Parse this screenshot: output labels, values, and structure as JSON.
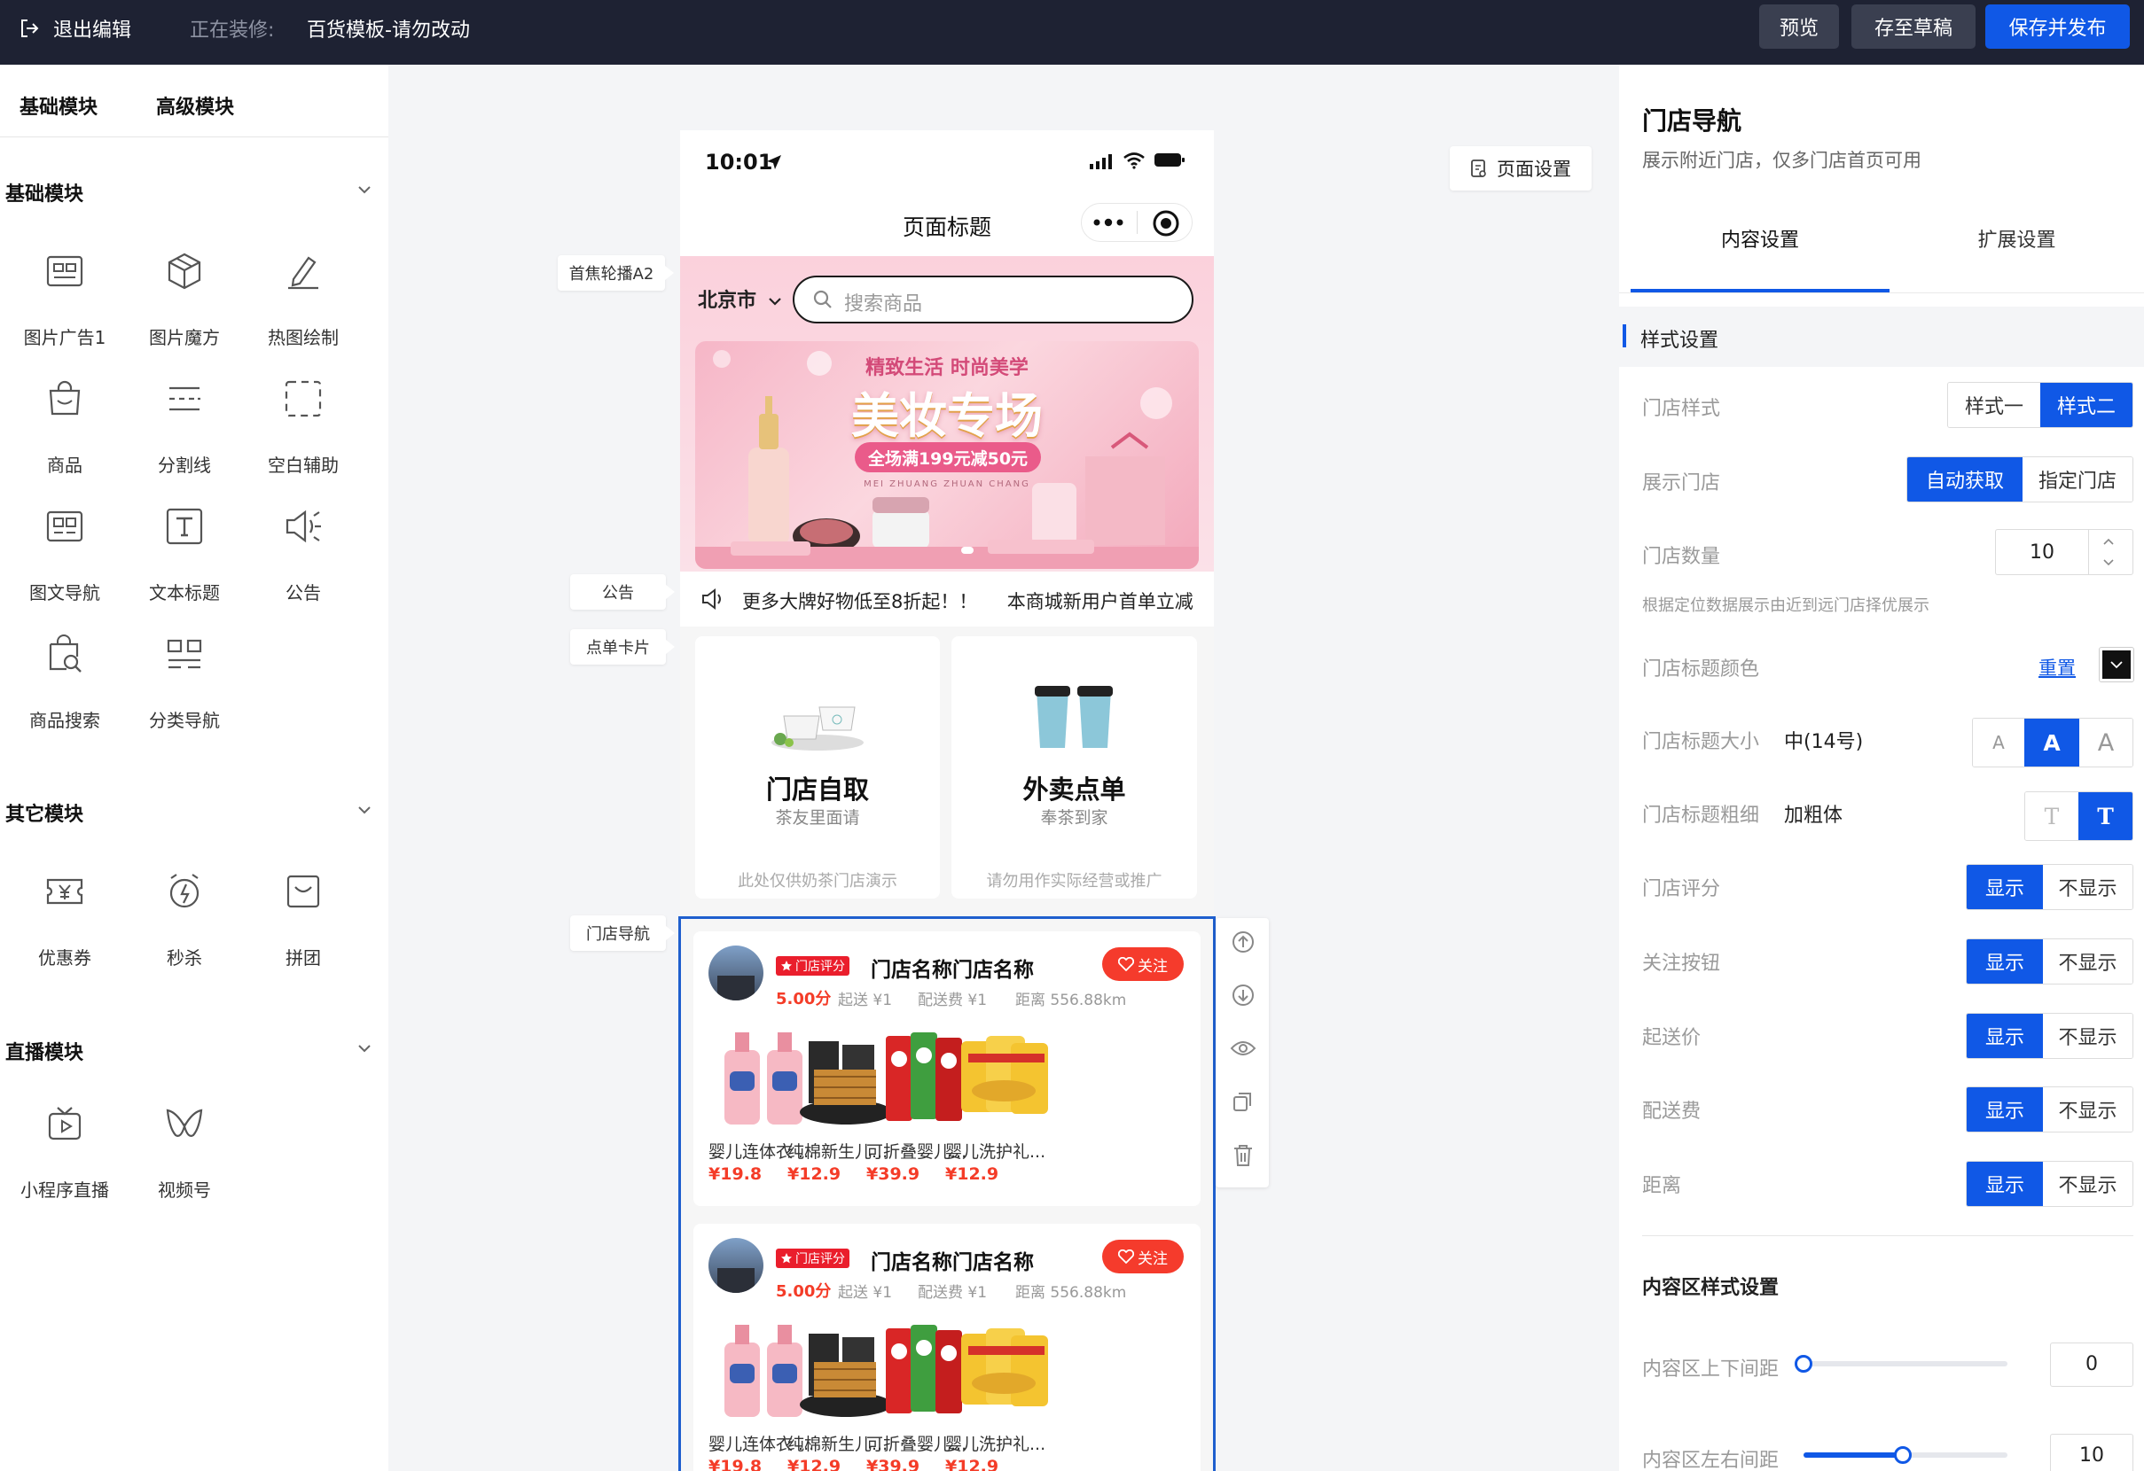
{
  "topbar": {
    "exit_label": "退出编辑",
    "editing_prefix": "正在装修:",
    "template_name": "百货模板-请勿改动",
    "preview_label": "预览",
    "draft_label": "存至草稿",
    "publish_label": "保存并发布"
  },
  "left": {
    "tabs": [
      "基础模块",
      "高级模块"
    ],
    "sections": {
      "basic": {
        "title": "基础模块",
        "items": [
          "图片广告1",
          "图片魔方",
          "热图绘制",
          "商品",
          "分割线",
          "空白辅助",
          "图文导航",
          "文本标题",
          "公告",
          "商品搜索",
          "分类导航"
        ]
      },
      "other": {
        "title": "其它模块",
        "items": [
          "优惠券",
          "秒杀",
          "拼团"
        ]
      },
      "live": {
        "title": "直播模块",
        "items": [
          "小程序直播",
          "视频号"
        ]
      }
    }
  },
  "canvas": {
    "labels": {
      "banner": "首焦轮播A2",
      "notice": "公告",
      "order_card": "点单卡片",
      "store_nav": "门店导航"
    },
    "page_settings_label": "页面设置"
  },
  "phone": {
    "time": "10:01",
    "page_title": "页面标题",
    "city": "北京市",
    "search_placeholder": "搜索商品",
    "banner": {
      "subtitle": "精致生活 时尚美学",
      "title": "美妆专场",
      "promo": "全场满199元减50元",
      "pinyin": "MEI ZHUANG ZHUAN CHANG"
    },
    "notice_text": "更多大牌好物低至8折起！！     本商城新用户首单立减",
    "order_cards": [
      {
        "title": "门店自取",
        "subtitle": "茶友里面请",
        "note": "此处仅供奶茶门店演示"
      },
      {
        "title": "外卖点单",
        "subtitle": "奉茶到家",
        "note": "请勿用作实际经营或推广"
      }
    ],
    "stores": [
      {
        "badge": "门店评分",
        "name": "门店名称门店名称",
        "follow": "关注",
        "score": "5.00分",
        "min_order": "起送 ¥1",
        "delivery_fee": "配送费 ¥1",
        "distance": "距离 556.88km",
        "products": [
          {
            "name": "婴儿连体衣 ...",
            "price": "¥19.8"
          },
          {
            "name": "纯棉新生儿...",
            "price": "¥12.9"
          },
          {
            "name": "可折叠婴儿...",
            "price": "¥39.9"
          },
          {
            "name": "婴儿洗护礼...",
            "price": "¥12.9"
          }
        ]
      },
      {
        "badge": "门店评分",
        "name": "门店名称门店名称",
        "follow": "关注",
        "score": "5.00分",
        "min_order": "起送 ¥1",
        "delivery_fee": "配送费 ¥1",
        "distance": "距离 556.88km",
        "products": [
          {
            "name": "婴儿连体衣 ...",
            "price": "¥19.8"
          },
          {
            "name": "纯棉新生儿...",
            "price": "¥12.9"
          },
          {
            "name": "可折叠婴儿...",
            "price": "¥39.9"
          },
          {
            "name": "婴儿洗护礼...",
            "price": "¥12.9"
          }
        ]
      }
    ]
  },
  "right": {
    "title": "门店导航",
    "description": "展示附近门店，仅多门店首页可用",
    "tabs": [
      "内容设置",
      "扩展设置"
    ],
    "style_section": "样式设置",
    "store_style": {
      "label": "门店样式",
      "options": [
        "样式一",
        "样式二"
      ],
      "selected": "样式二"
    },
    "show_store": {
      "label": "展示门店",
      "options": [
        "自动获取",
        "指定门店"
      ],
      "selected": "自动获取"
    },
    "store_count": {
      "label": "门店数量",
      "value": "10"
    },
    "hint": "根据定位数据展示由近到远门店择优展示",
    "title_color": {
      "label": "门店标题颜色",
      "reset": "重置"
    },
    "title_size": {
      "label": "门店标题大小",
      "value": "中(14号)",
      "options": [
        "A",
        "A",
        "A"
      ]
    },
    "title_weight": {
      "label": "门店标题粗细",
      "value": "加粗体",
      "options": [
        "T",
        "T"
      ]
    },
    "toggles": [
      {
        "label": "门店评分",
        "on": "显示",
        "off": "不显示"
      },
      {
        "label": "关注按钮",
        "on": "显示",
        "off": "不显示"
      },
      {
        "label": "起送价",
        "on": "显示",
        "off": "不显示"
      },
      {
        "label": "配送费",
        "on": "显示",
        "off": "不显示"
      },
      {
        "label": "距离",
        "on": "显示",
        "off": "不显示"
      }
    ],
    "content_style_title": "内容区样式设置",
    "v_padding": {
      "label": "内容区上下间距",
      "value": "0"
    },
    "h_padding": {
      "label": "内容区左右间距",
      "value": "10"
    }
  },
  "colors": {
    "topbar": "#1e2233",
    "accent": "#1058e6",
    "price": "#f43c28",
    "follow": "#f53b2c"
  }
}
